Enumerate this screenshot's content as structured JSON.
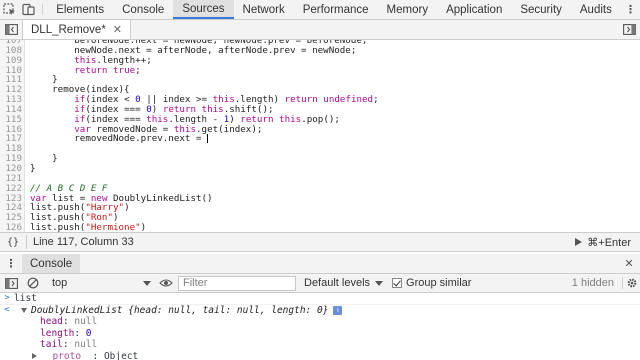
{
  "toolbar": {
    "tabs": [
      "Elements",
      "Console",
      "Sources",
      "Network",
      "Performance",
      "Memory",
      "Application",
      "Security",
      "Audits"
    ],
    "active_tab": "Sources"
  },
  "editor": {
    "file_tab": "DLL_Remove*",
    "status_position": "Line 117, Column 33",
    "run_shortcut": "⌘+Enter"
  },
  "code_lines": [
    {
      "n": "107",
      "text": "        beforeNode.next = newNode, newNode.prev = beforeNode;"
    },
    {
      "n": "108",
      "text": "        newNode.next = afterNode, afterNode.prev = newNode;"
    },
    {
      "n": "109",
      "text": "        this.length++;"
    },
    {
      "n": "110",
      "text": "        return true;"
    },
    {
      "n": "111",
      "text": "    }"
    },
    {
      "n": "112",
      "text": "    remove(index){"
    },
    {
      "n": "113",
      "text": "        if(index < 0 || index >= this.length) return undefined;"
    },
    {
      "n": "114",
      "text": "        if(index === 0) return this.shift();"
    },
    {
      "n": "115",
      "text": "        if(index === this.length - 1) return this.pop();"
    },
    {
      "n": "116",
      "text": "        var removedNode = this.get(index);"
    },
    {
      "n": "117",
      "text": "        removedNode.prev.next = "
    },
    {
      "n": "118",
      "text": ""
    },
    {
      "n": "119",
      "text": "    }"
    },
    {
      "n": "120",
      "text": "}"
    },
    {
      "n": "121",
      "text": ""
    },
    {
      "n": "122",
      "text": "// A B C D E F"
    },
    {
      "n": "123",
      "text": "var list = new DoublyLinkedList()"
    },
    {
      "n": "124",
      "text": "list.push(\"Harry\")"
    },
    {
      "n": "125",
      "text": "list.push(\"Ron\")"
    },
    {
      "n": "126",
      "text": "list.push(\"Hermione\")"
    }
  ],
  "drawer": {
    "tab": "Console"
  },
  "console_toolbar": {
    "context": "top",
    "filter_placeholder": "Filter",
    "levels": "Default levels",
    "group_similar": "Group similar",
    "hidden_count": "1 hidden"
  },
  "console": {
    "input": "list",
    "object_head": "DoublyLinkedList {head: null, tail: null, length: 0}",
    "props": [
      {
        "name": "head",
        "value": "null"
      },
      {
        "name": "length",
        "value": "0"
      },
      {
        "name": "tail",
        "value": "null"
      }
    ],
    "proto_name": "__proto__",
    "proto_value": "Object"
  },
  "colors": {
    "accent": "#3879d9",
    "keyword": "#aa0d91",
    "string": "#c41a16",
    "number": "#1c00cf",
    "comment": "#236e25"
  }
}
